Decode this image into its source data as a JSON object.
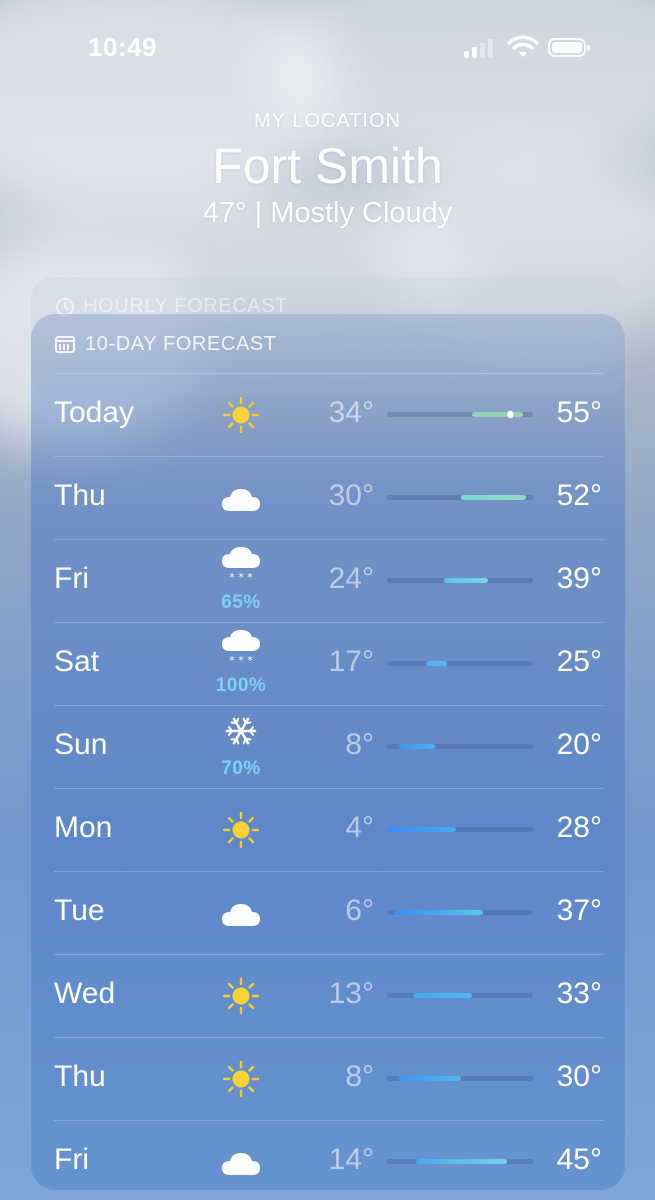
{
  "status": {
    "time": "10:49"
  },
  "header": {
    "location_label": "MY LOCATION",
    "city": "Fort Smith",
    "summary": "47°  |  Mostly Cloudy"
  },
  "hourly": {
    "title": "HOURLY FORECAST",
    "icon": "clock-icon"
  },
  "forecast": {
    "title": "10-DAY FORECAST",
    "icon": "calendar-icon",
    "days": [
      {
        "day": "Today",
        "icon": "sun-icon",
        "precip": "",
        "low": "34°",
        "high": "55°",
        "bar_start": 0.58,
        "bar_end": 0.93,
        "current_marker": 0.84,
        "colors": [
          "#8fd3c0",
          "#9bd7a3"
        ]
      },
      {
        "day": "Thu",
        "icon": "cloud-icon",
        "precip": "",
        "low": "30°",
        "high": "52°",
        "bar_start": 0.51,
        "bar_end": 0.95,
        "colors": [
          "#7ed7d6",
          "#8fdcc4"
        ]
      },
      {
        "day": "Fri",
        "icon": "snow-cloud-icon",
        "precip": "65%",
        "low": "24°",
        "high": "39°",
        "bar_start": 0.39,
        "bar_end": 0.69,
        "colors": [
          "#5cc2ee",
          "#7bd5e6"
        ]
      },
      {
        "day": "Sat",
        "icon": "snow-cloud-icon",
        "precip": "100%",
        "low": "17°",
        "high": "25°",
        "bar_start": 0.27,
        "bar_end": 0.41,
        "colors": [
          "#4fb0ef",
          "#56bdf0"
        ]
      },
      {
        "day": "Sun",
        "icon": "snowflake-icon",
        "precip": "70%",
        "low": "8°",
        "high": "20°",
        "bar_start": 0.08,
        "bar_end": 0.33,
        "colors": [
          "#3f98ef",
          "#4bb0f0"
        ]
      },
      {
        "day": "Mon",
        "icon": "sun-icon",
        "precip": "",
        "low": "4°",
        "high": "28°",
        "bar_start": 0.0,
        "bar_end": 0.47,
        "colors": [
          "#3a8cef",
          "#4aaaf0"
        ]
      },
      {
        "day": "Tue",
        "icon": "cloud-icon",
        "precip": "",
        "low": "6°",
        "high": "37°",
        "bar_start": 0.05,
        "bar_end": 0.66,
        "colors": [
          "#3a8eef",
          "#5cc6ee"
        ]
      },
      {
        "day": "Wed",
        "icon": "sun-icon",
        "precip": "",
        "low": "13°",
        "high": "33°",
        "bar_start": 0.18,
        "bar_end": 0.58,
        "colors": [
          "#45a5f0",
          "#52b8ef"
        ]
      },
      {
        "day": "Thu",
        "icon": "sun-icon",
        "precip": "",
        "low": "8°",
        "high": "30°",
        "bar_start": 0.08,
        "bar_end": 0.51,
        "colors": [
          "#3e96ef",
          "#52b6ef"
        ]
      },
      {
        "day": "Fri",
        "icon": "cloud-icon",
        "precip": "",
        "low": "14°",
        "high": "45°",
        "bar_start": 0.2,
        "bar_end": 0.82,
        "colors": [
          "#4ba8ef",
          "#76d2e8"
        ]
      }
    ]
  }
}
